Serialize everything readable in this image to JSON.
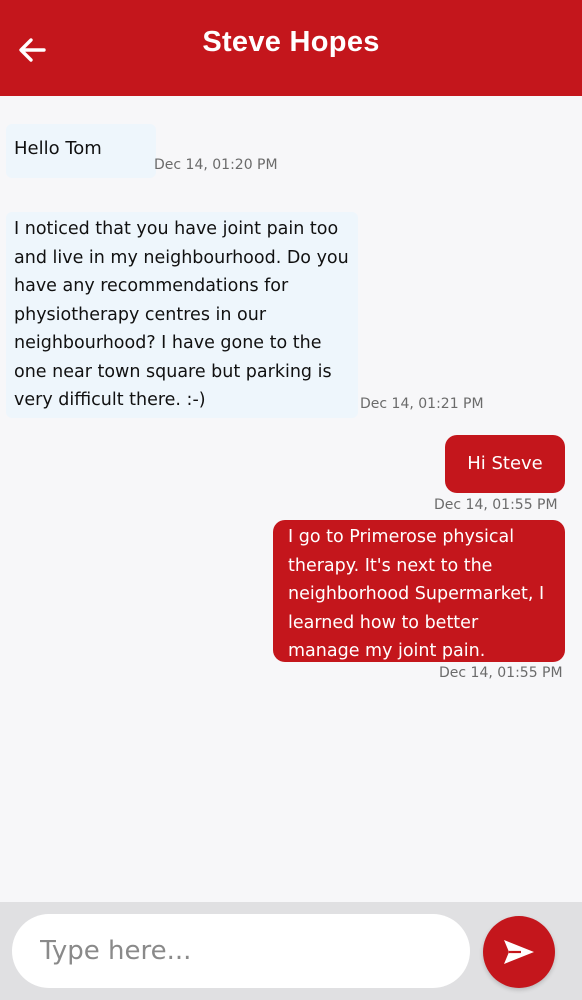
{
  "header": {
    "title": "Steve Hopes",
    "back_icon": "arrow-left-icon"
  },
  "messages": [
    {
      "direction": "incoming",
      "text": "Hello Tom",
      "time": "Dec 14, 01:20 PM"
    },
    {
      "direction": "incoming",
      "text": "I noticed that you have joint pain too and live in my neighbourhood. Do you have any recommendations for physiotherapy centres in our neighbourhood? I have gone to the one near town square but parking is very difficult there. :-)",
      "time": "Dec 14, 01:21 PM"
    },
    {
      "direction": "outgoing",
      "text": "Hi Steve",
      "time": "Dec 14, 01:55 PM"
    },
    {
      "direction": "outgoing",
      "text": "I go to Primerose physical therapy. It's next to the neighborhood Supermarket, I learned how to better manage my joint pain.",
      "time": "Dec 14, 01:55 PM"
    }
  ],
  "composer": {
    "placeholder": "Type here...",
    "value": "",
    "send_icon": "send-icon"
  },
  "colors": {
    "brand_red": "#c4161c",
    "incoming_bubble": "#eef6fc",
    "chat_background": "#f7f7f9",
    "footer_background": "#e0e0e2",
    "timestamp": "#6b6b6b"
  }
}
